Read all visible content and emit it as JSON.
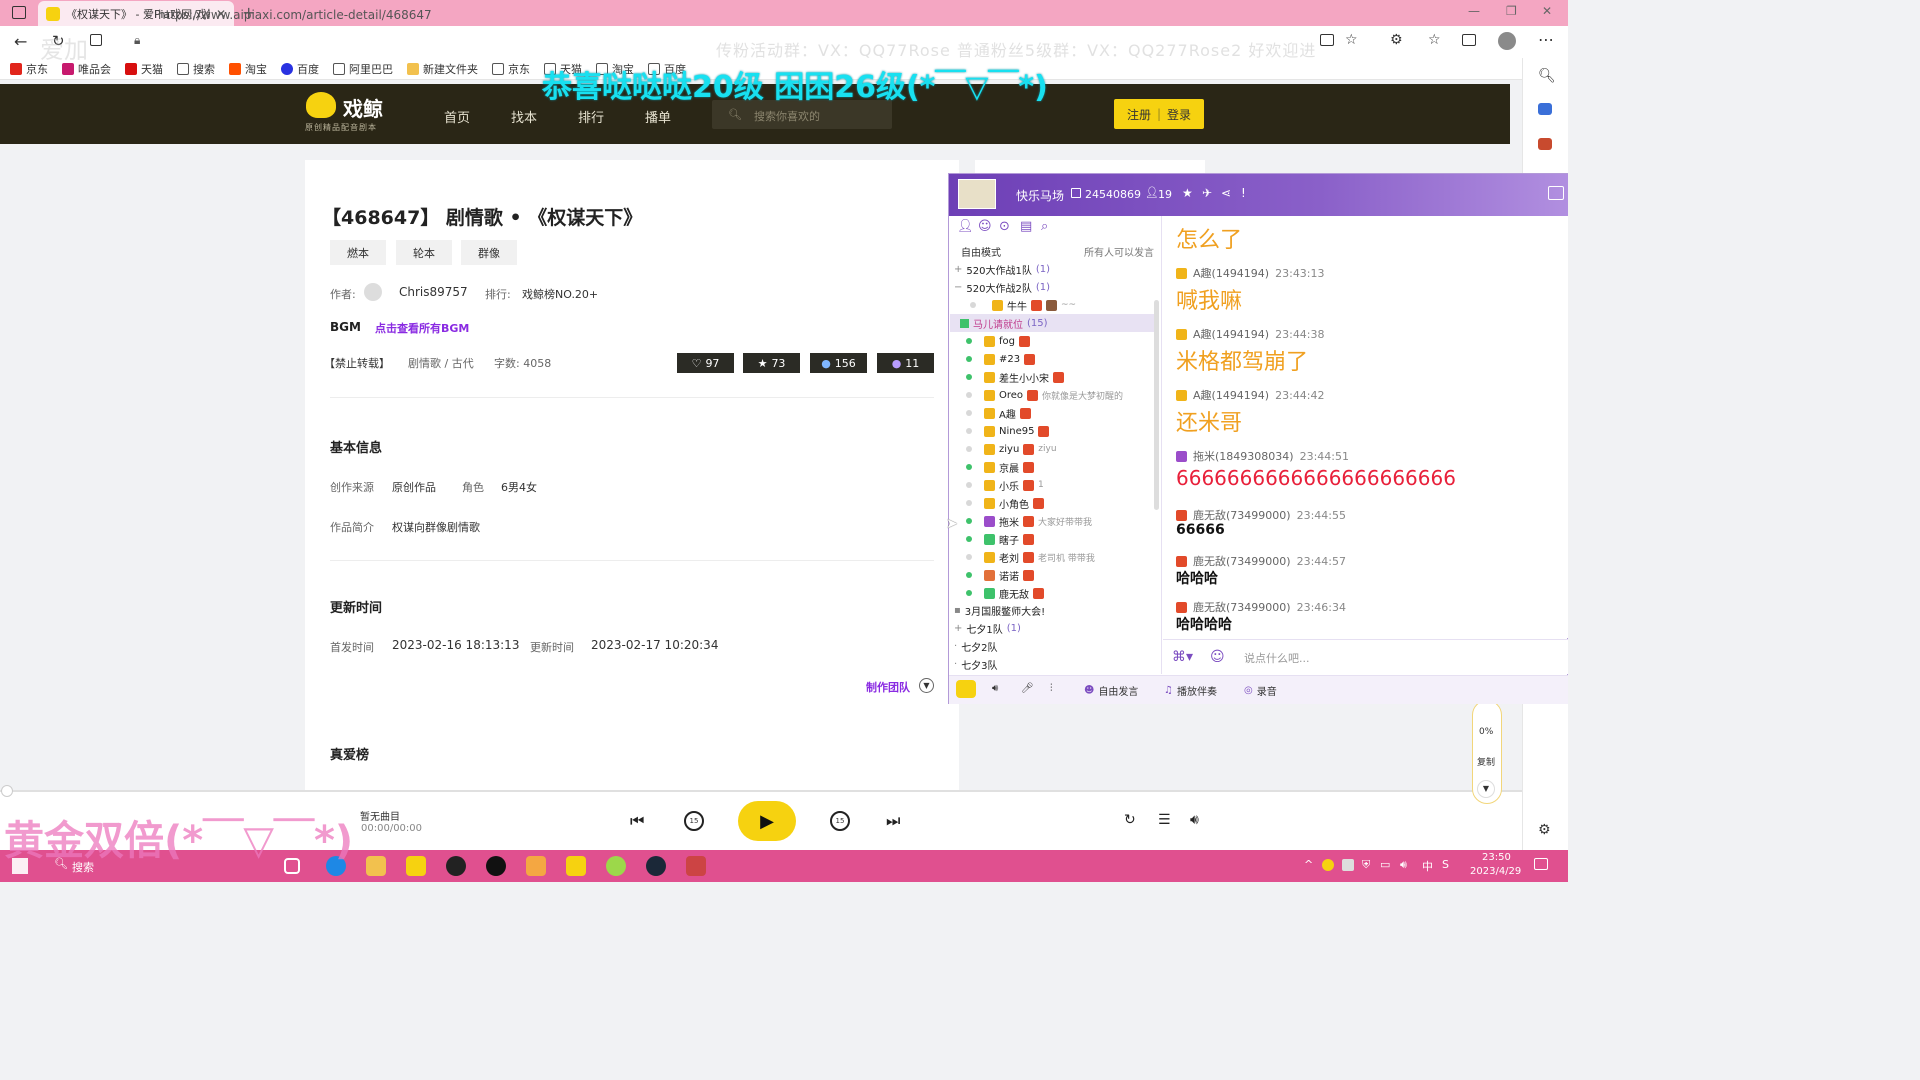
{
  "browser": {
    "tab_title": "《权谋天下》 - 爱Pia戏网,戏鲸A",
    "url": "https://www.aipiaxi.com/article-detail/468647",
    "bookmarks": [
      "京东",
      "唯品会",
      "天猫",
      "搜索",
      "淘宝",
      "百度",
      "阿里巴巴",
      "新建文件夹",
      "京东",
      "天猫",
      "淘宝",
      "百度"
    ]
  },
  "overlays": {
    "congrats": "恭喜哒哒哒20级 困困26级(*￣▽￣*)",
    "group_info": "传粉活动群：VX：QQ77Rose     普通粉丝5级群：VX：QQ277Rose2 好欢迎进",
    "double": "黄金双倍(*￣▽￣*)",
    "watermark": "爱加"
  },
  "site": {
    "logo": "戏鲸",
    "logo_sub": "原创精品配音剧本",
    "nav": [
      "首页",
      "找本",
      "排行",
      "播单"
    ],
    "search_placeholder": "搜索你喜欢的",
    "register": "注册",
    "login": "登录"
  },
  "article": {
    "title": "【468647】 剧情歌 • 《权谋天下》",
    "tags": [
      "燃本",
      "轮本",
      "群像"
    ],
    "author_label": "作者:",
    "author": "Chris89757",
    "rank_label": "排行:",
    "rank": "戏鲸榜NO.20+",
    "bgm_label": "BGM",
    "bgm_link": "点击查看所有BGM",
    "notice": "【禁止转载】",
    "genre": "剧情歌 / 古代",
    "word_count": "字数: 4058",
    "stats": {
      "likes": "97",
      "stars": "73",
      "comments": "156",
      "plays": "11"
    },
    "basic_info_title": "基本信息",
    "source_label": "创作来源",
    "source": "原创作品",
    "role_label": "角色",
    "roles": "6男4女",
    "intro_label": "作品简介",
    "intro": "权谋向群像剧情歌",
    "update_title": "更新时间",
    "first_label": "首发时间",
    "first_time": "2023-02-16 18:13:13",
    "update_label": "更新时间",
    "update_time": "2023-02-17 10:20:34",
    "team_link": "制作团队",
    "fans_title": "真爱榜"
  },
  "player": {
    "track": "暂无曲目",
    "time": "00:00/00:00"
  },
  "helper": {
    "percent": "0%",
    "copy": "复制"
  },
  "chat": {
    "room_name": "快乐马场",
    "room_id": "24540869",
    "users": "19",
    "mode": "自由模式",
    "mode_right": "所有人可以发言",
    "tree": [
      {
        "name": "520大作战1队",
        "count": "(1)"
      },
      {
        "name": "520大作战2队",
        "count": "(1)"
      },
      {
        "name": "马儿请就位",
        "count": "(15)"
      },
      {
        "name": "3月国服鳖师大会!",
        "count": ""
      },
      {
        "name": "七夕1队",
        "count": "(1)"
      },
      {
        "name": "七夕2队",
        "count": ""
      },
      {
        "name": "七夕3队",
        "count": ""
      }
    ],
    "sub_member": {
      "name": "牛牛",
      "sig": "~~"
    },
    "members": [
      {
        "name": "fog",
        "sig": ""
      },
      {
        "name": "#23",
        "sig": ""
      },
      {
        "name": "差生小小宋",
        "sig": ""
      },
      {
        "name": "Oreo",
        "sig": "你就像是大梦初醒的"
      },
      {
        "name": "A趣",
        "sig": ""
      },
      {
        "name": "Nine95",
        "sig": ""
      },
      {
        "name": "ziyu",
        "sig": "ziyu"
      },
      {
        "name": "京晨",
        "sig": ""
      },
      {
        "name": "小乐",
        "sig": "1"
      },
      {
        "name": "小角色",
        "sig": ""
      },
      {
        "name": "拖米",
        "sig": "大家好带带我"
      },
      {
        "name": "瞎子",
        "sig": ""
      },
      {
        "name": "老刘",
        "sig": "老司机 带带我"
      },
      {
        "name": "诺诺",
        "sig": ""
      },
      {
        "name": "鹿无敌",
        "sig": ""
      }
    ],
    "messages": [
      {
        "user": "",
        "time": "",
        "text": "怎么了"
      },
      {
        "user": "A趣(1494194)",
        "time": "23:43:13",
        "text": "喊我嘛"
      },
      {
        "user": "A趣(1494194)",
        "time": "23:44:38",
        "text": "米格都驾崩了"
      },
      {
        "user": "A趣(1494194)",
        "time": "23:44:42",
        "text": "还米哥"
      },
      {
        "user": "拖米(1849308034)",
        "time": "23:44:51",
        "text": "6666666666666666666666"
      },
      {
        "user": "鹿无敌(73499000)",
        "time": "23:44:55",
        "text": "66666"
      },
      {
        "user": "鹿无敌(73499000)",
        "time": "23:44:57",
        "text": "哈哈哈"
      },
      {
        "user": "鹿无敌(73499000)",
        "time": "23:46:34",
        "text": "哈哈哈哈"
      }
    ],
    "input_placeholder": "说点什么吧...",
    "toolbar": {
      "free_speak": "自由发言",
      "play_music": "播放伴奏",
      "record": "录音"
    }
  },
  "taskbar": {
    "search": "搜索",
    "time": "23:50",
    "date": "2023/4/29",
    "ime": "中"
  },
  "colors": {
    "accent": "#f6d210",
    "header": "#2a2616",
    "chat_purple": "#7b4cc0",
    "taskbar": "#e0508f",
    "titlebar": "#f4a6c2"
  }
}
